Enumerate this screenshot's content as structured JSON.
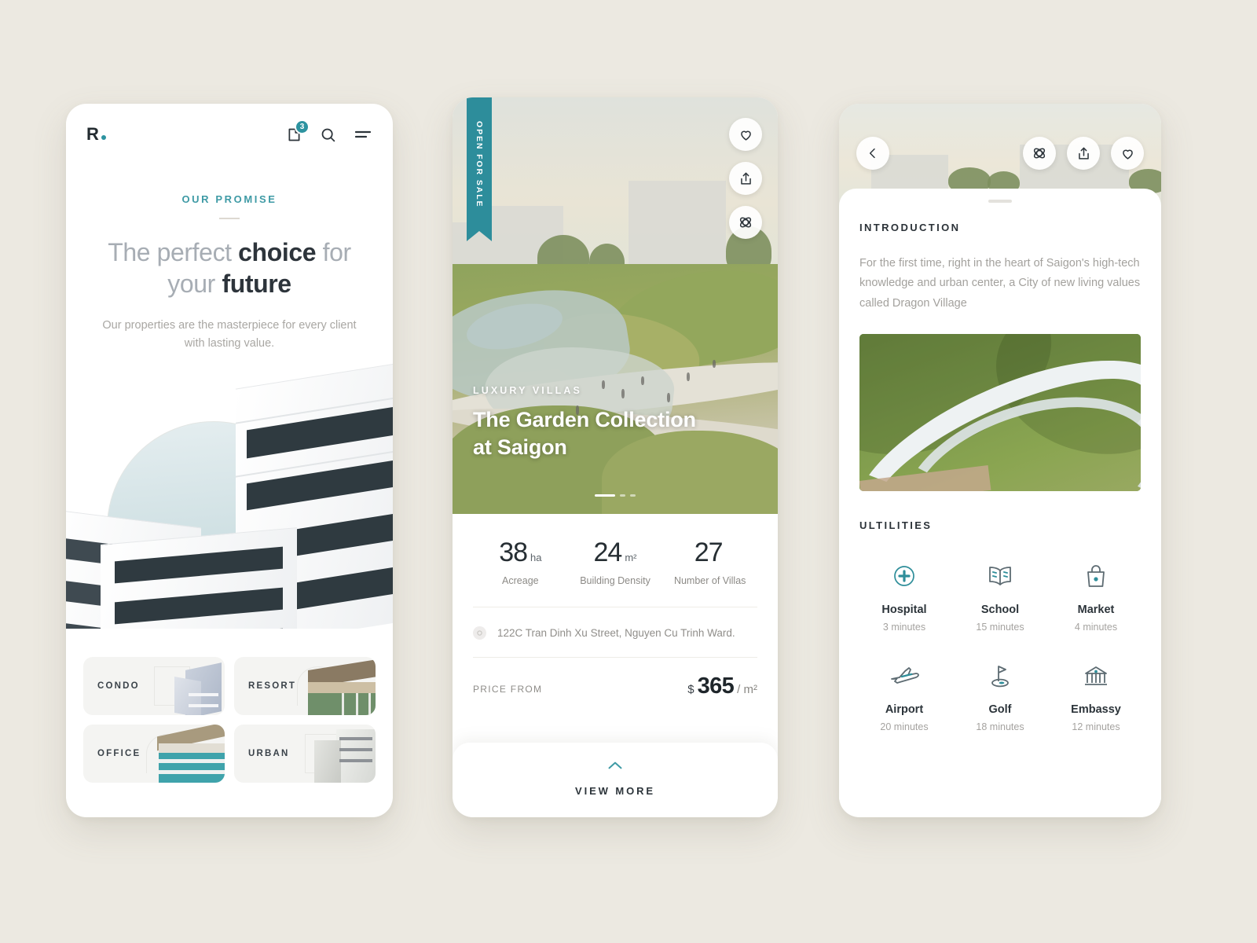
{
  "theme": {
    "background": "#ece9e1",
    "accent_teal": "#2d8d9b",
    "accent_teal_light": "#3e9aa5",
    "text_dark": "#2c343a",
    "text_muted": "#a3a19d"
  },
  "screen1": {
    "logo": "R",
    "logo_dot_icon": "dot-icon",
    "header_icons": [
      {
        "name": "bookmark-icon",
        "badge": "3"
      },
      {
        "name": "search-icon",
        "badge": ""
      },
      {
        "name": "menu-icon",
        "badge": ""
      }
    ],
    "eyebrow": "OUR PROMISE",
    "title_part1": "The perfect ",
    "title_bold1": "choice",
    "title_part2": " for",
    "title_part3": "your ",
    "title_bold2": "future",
    "subtitle": "Our properties are the masterpiece for every client with lasting value.",
    "categories": [
      {
        "label": "CONDO"
      },
      {
        "label": "RESORT"
      },
      {
        "label": "OFFICE"
      },
      {
        "label": "URBAN"
      }
    ]
  },
  "screen2": {
    "ribbon": "OPEN FOR SALE",
    "actions": [
      {
        "name": "heart-icon"
      },
      {
        "name": "share-icon"
      },
      {
        "name": "view-360-icon"
      }
    ],
    "kicker": "LUXURY VILLAS",
    "title_line1": "The Garden Collection",
    "title_line2": "at Saigon",
    "stats": [
      {
        "value": "38",
        "unit": "ha",
        "label": "Acreage"
      },
      {
        "value": "24",
        "unit": "m²",
        "label": "Building Density"
      },
      {
        "value": "27",
        "unit": "",
        "label": "Number of Villas"
      }
    ],
    "address": "122C Tran Dinh Xu Street, Nguyen Cu Trinh Ward.",
    "address_icon": "location-pin-icon",
    "price_label": "PRICE FROM",
    "price_currency": "$",
    "price_amount": "365",
    "price_unit": "/ m²",
    "view_more": "VIEW MORE",
    "view_more_icon": "chevron-up-icon"
  },
  "screen3": {
    "back_icon": "chevron-left-icon",
    "actions": [
      {
        "name": "view-360-icon"
      },
      {
        "name": "share-icon"
      },
      {
        "name": "heart-icon"
      }
    ],
    "intro_title": "INTRODUCTION",
    "intro_body": "For the first time, right in the heart of Saigon's high-tech knowledge and urban center, a City of new living values called Dragon Village",
    "utilities_title": "ULTILITIES",
    "utilities": [
      {
        "icon": "hospital-icon",
        "name": "Hospital",
        "time": "3 minutes"
      },
      {
        "icon": "school-icon",
        "name": "School",
        "time": "15 minutes"
      },
      {
        "icon": "market-icon",
        "name": "Market",
        "time": "4 minutes"
      },
      {
        "icon": "airport-icon",
        "name": "Airport",
        "time": "20 minutes"
      },
      {
        "icon": "golf-icon",
        "name": "Golf",
        "time": "18 minutes"
      },
      {
        "icon": "embassy-icon",
        "name": "Embassy",
        "time": "12 minutes"
      }
    ]
  }
}
